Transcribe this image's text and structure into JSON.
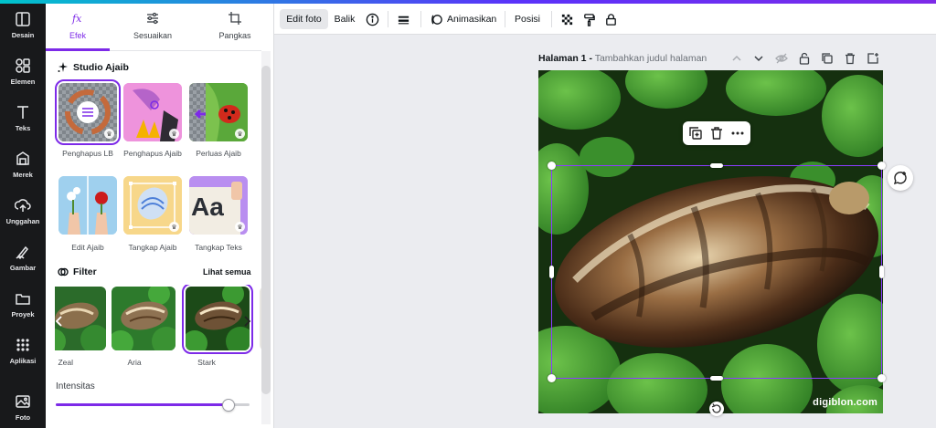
{
  "rail": {
    "items": [
      {
        "label": "Desain",
        "icon": "layout-icon"
      },
      {
        "label": "Elemen",
        "icon": "shapes-icon"
      },
      {
        "label": "Teks",
        "icon": "text-icon"
      },
      {
        "label": "Merek",
        "icon": "brand-icon"
      },
      {
        "label": "Unggahan",
        "icon": "upload-icon"
      },
      {
        "label": "Gambar",
        "icon": "draw-icon"
      },
      {
        "label": "Proyek",
        "icon": "folder-icon"
      },
      {
        "label": "Aplikasi",
        "icon": "apps-icon"
      },
      {
        "label": "Foto",
        "icon": "photo-icon"
      }
    ]
  },
  "panel": {
    "tabs": [
      {
        "label": "Efek",
        "active": true
      },
      {
        "label": "Sesuaikan",
        "active": false
      },
      {
        "label": "Pangkas",
        "active": false
      }
    ],
    "studio": {
      "title": "Studio Ajaib",
      "tools": [
        {
          "label": "Penghapus LB"
        },
        {
          "label": "Penghapus Ajaib"
        },
        {
          "label": "Perluas Ajaib"
        },
        {
          "label": "Edit Ajaib"
        },
        {
          "label": "Tangkap Ajaib"
        },
        {
          "label": "Tangkap Teks"
        }
      ],
      "tile_text": "Aa"
    },
    "filter": {
      "title": "Filter",
      "see_all": "Lihat semua",
      "items": [
        {
          "label": "Zeal"
        },
        {
          "label": "Aria"
        },
        {
          "label": "Stark"
        }
      ]
    },
    "intensity": {
      "label": "Intensitas",
      "value": 0.89
    }
  },
  "toolbar": {
    "edit_photo": "Edit foto",
    "flip": "Balik",
    "animate": "Animasikan",
    "position": "Posisi"
  },
  "page": {
    "title": "Halaman 1 -",
    "subtitle": "Tambahkan judul halaman"
  },
  "canvas": {
    "watermark": "digiblon.com"
  },
  "colors": {
    "accent": "#7d2ae8",
    "rail_bg": "#18191b",
    "canvas_bg": "#ebecf0"
  }
}
